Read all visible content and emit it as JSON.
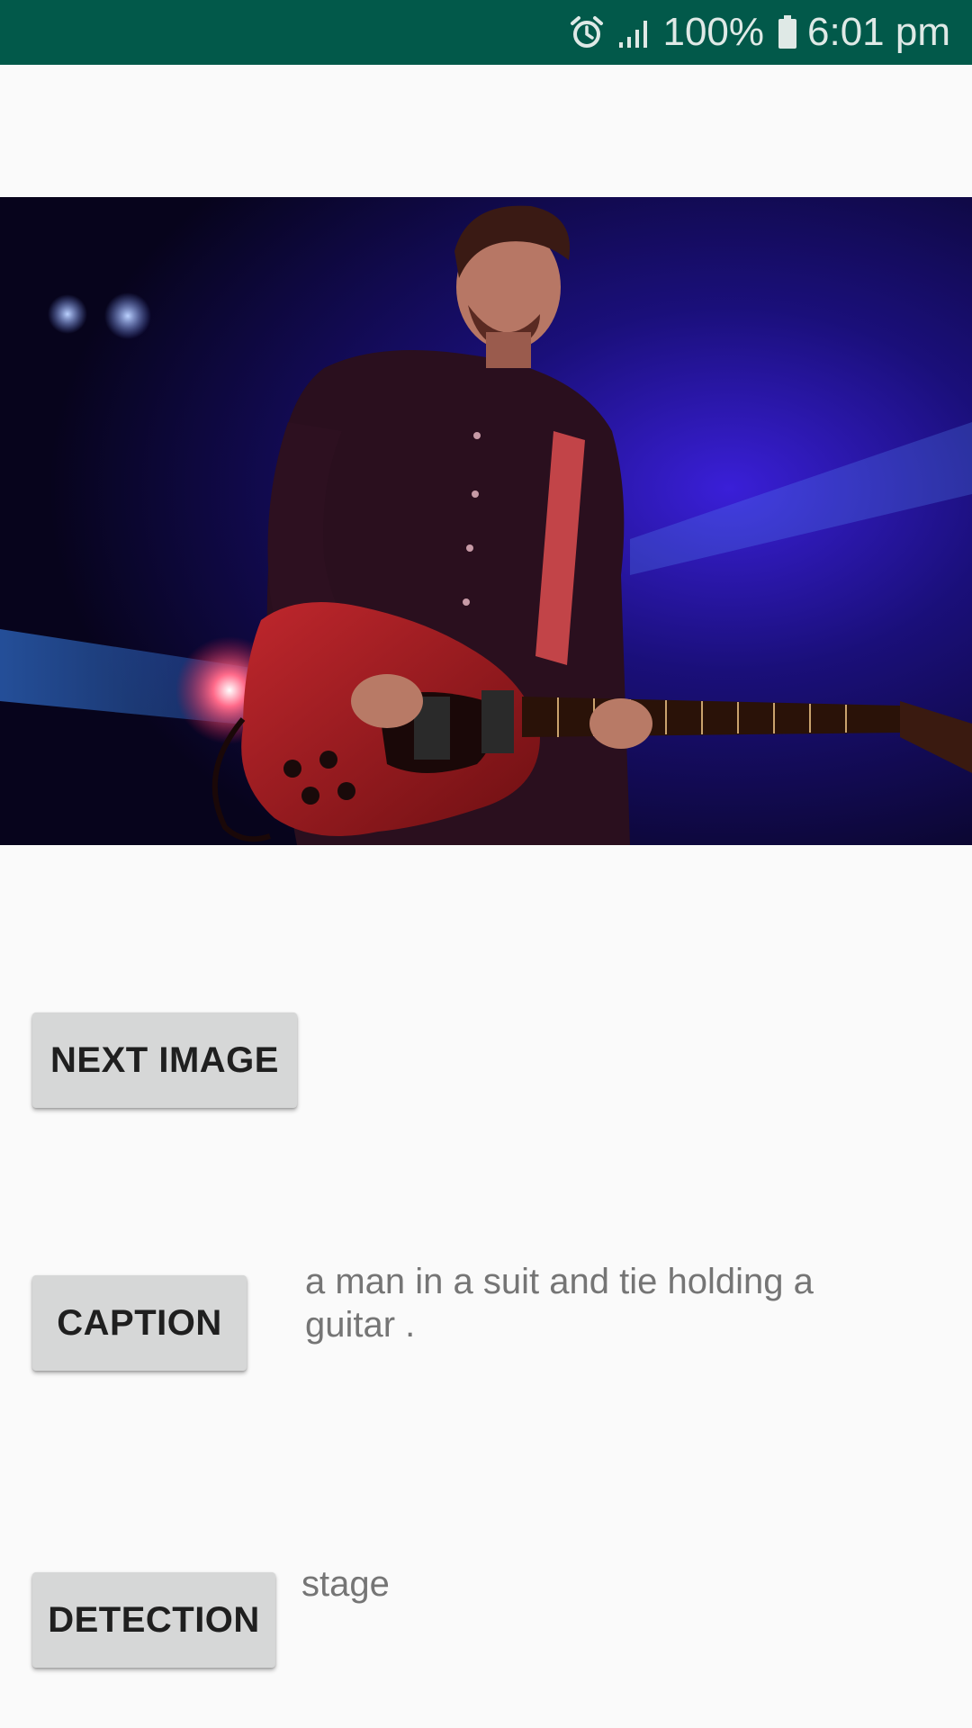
{
  "status_bar": {
    "battery_percent": "100%",
    "time": "6:01 pm",
    "icons": [
      "alarm-icon",
      "signal-icon",
      "battery-icon"
    ],
    "background_color": "#02594a"
  },
  "photo": {
    "subject": "guitarist-on-stage-photo"
  },
  "buttons": {
    "next_image": "NEXT IMAGE",
    "caption": "CAPTION",
    "detection": "DETECTION"
  },
  "results": {
    "caption": "a man in a suit and tie holding a guitar .",
    "detection": "stage"
  },
  "colors": {
    "button_bg": "#d6d7d7",
    "result_text": "#757575",
    "page_bg": "#fafafa"
  }
}
